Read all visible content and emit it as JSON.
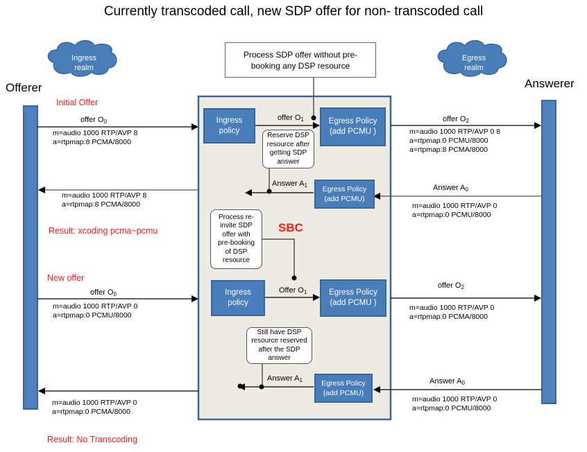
{
  "title": "Currently transcoded call, new SDP offer for non- transcoded call",
  "actors": {
    "offerer": "Offerer",
    "answerer": "Answerer"
  },
  "clouds": {
    "ingress": [
      "Ingress",
      "realm"
    ],
    "egress": [
      "Egress",
      "realm"
    ]
  },
  "colors": {
    "box_fill": "#4a7ebb",
    "sbc_fill": "#eeebe2",
    "accent_red": "#ff1a1a"
  },
  "sbc_label": "SBC",
  "top_note": "Process SDP offer without pre-booking any DSP resource",
  "phase1": {
    "heading": "Initial Offer",
    "offer_o0": {
      "label": "offer O",
      "sub": "0",
      "sdp": [
        "m=audio 1000 RTP/AVP 8",
        "a=rtpmap:8 PCMA/8000"
      ]
    },
    "ingress_policy": [
      "Ingress",
      "policy"
    ],
    "offer_o1": {
      "label": "offer O",
      "sub": "1"
    },
    "egress_policy_top": [
      "Egress Policy",
      "(add PCMU )"
    ],
    "note_reserve": [
      "Reserve DSP",
      "resource after",
      "getting SDP",
      "answer"
    ],
    "offer_o2": {
      "label": "offer O",
      "sub": "2",
      "sdp": [
        "m=audio 1000 RTP/AVP 0 8",
        "a=rtpmap:0 PCMU/8000",
        "a=rtpmap:8 PCMA/8000"
      ]
    },
    "answer_a0": {
      "label": "Answer A",
      "sub": "0",
      "sdp": [
        "m=audio 1000 RTP/AVP 0",
        "a=rtpmap:0 PCMU/8000"
      ]
    },
    "egress_policy_bottom": [
      "Egress Policy",
      "(add PCMU)"
    ],
    "answer_a1": {
      "label": "Answer A",
      "sub": "1"
    },
    "answer_back_sdp": [
      "m=audio 1000 RTP/AVP 8",
      "a=rtpmap:8 PCMA/8000"
    ],
    "result": "Result: xcoding pcma~pcmu"
  },
  "phase2": {
    "heading": "New offer",
    "note_process": [
      "Process re-",
      "invite SDP",
      "offer with",
      "pre-booking",
      "of DSP",
      "resource"
    ],
    "offer_o0": {
      "label": "offer O",
      "sub": "0",
      "sdp": [
        "m=audio 1000 RTP/AVP 0",
        "a=rtpmap:0 PCMU/8000"
      ]
    },
    "ingress_policy": [
      "Ingress",
      "policy"
    ],
    "offer_o1": {
      "label": "Offer O",
      "sub": "1"
    },
    "egress_policy_top": [
      "Egress Policy",
      "(add PCMU )"
    ],
    "offer_o2": {
      "label": "offer O",
      "sub": "2",
      "sdp": [
        "m=audio 1000 RTP/AVP 0",
        "a=rtpmap:0 PCMA/8000"
      ]
    },
    "note_still": [
      "Still have DSP",
      "resource reserved",
      "after the SDP",
      "answer"
    ],
    "answer_a0": {
      "label": "Answer A",
      "sub": "0",
      "sdp": [
        "m=audio 1000 RTP/AVP 0",
        "a=rtpmap:0 PCMU/8000"
      ]
    },
    "egress_policy_bottom": [
      "Egress Policy",
      "(add PCMU)"
    ],
    "answer_a1": {
      "label": "Answer A",
      "sub": "1"
    },
    "answer_back_sdp": [
      "m=audio 1000 RTP/AVP 0",
      "a=rtpmap:0 PCMA/8000"
    ],
    "result": "Result: No Transcoding"
  }
}
